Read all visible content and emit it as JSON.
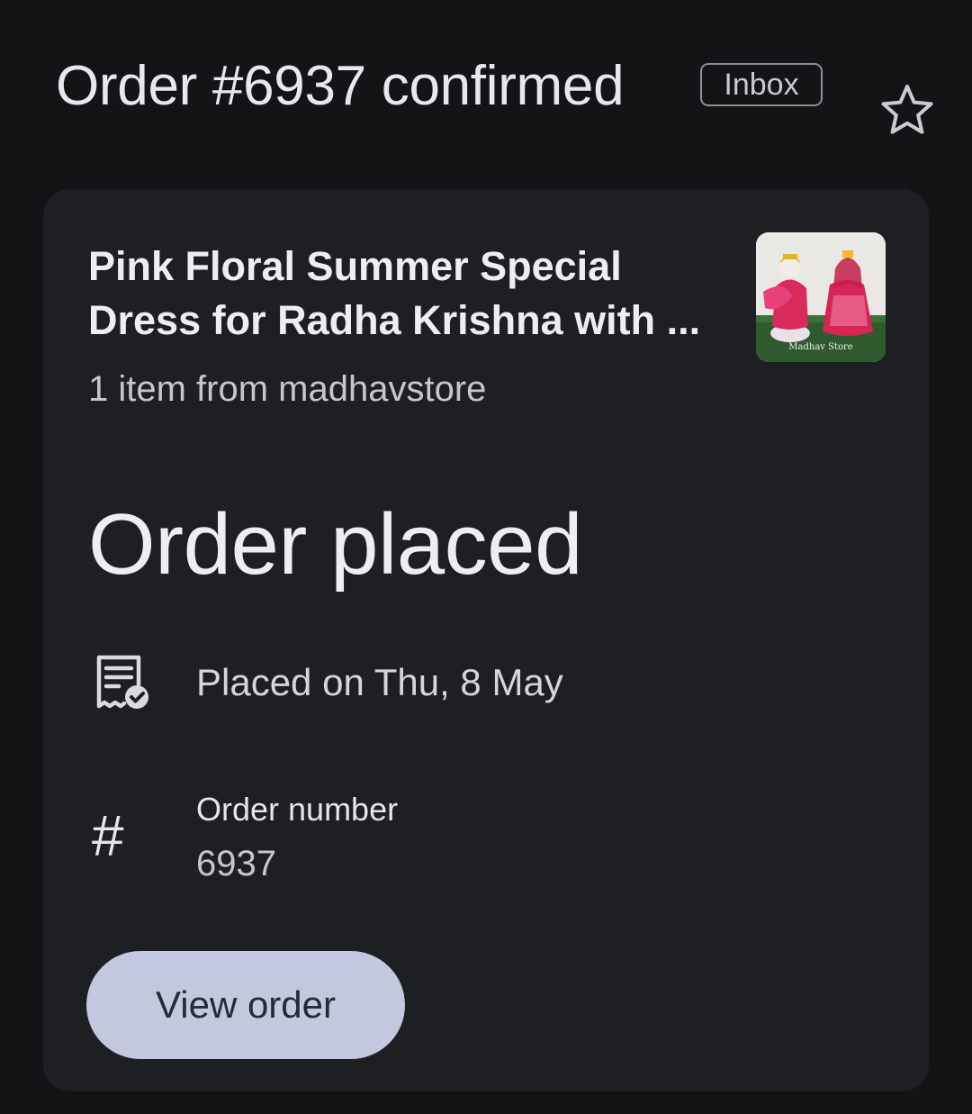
{
  "email": {
    "subject": "Order #6937 confirmed",
    "label": "Inbox",
    "starred": false
  },
  "order": {
    "product_title_line1": "Pink Floral Summer Special",
    "product_title_line2": "Dress for Radha Krishna with ...",
    "items_from": "1 item from madhavstore",
    "status": "Order placed",
    "placed_on": "Placed on Thu, 8 May",
    "order_number_label": "Order number",
    "order_number": "6937",
    "thumbnail_watermark": "Madhav Store"
  },
  "actions": {
    "view_order_label": "View order"
  },
  "icons": {
    "star": "star-outline-icon",
    "receipt": "receipt-check-icon",
    "hash": "#"
  },
  "colors": {
    "background": "#131416",
    "card": "#1d1f23",
    "button": "#c3c8de"
  }
}
